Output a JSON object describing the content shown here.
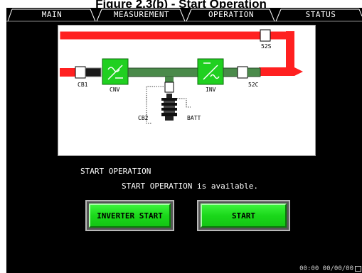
{
  "caption": "Figure 2.3(b) - Start Operation",
  "tabs": [
    {
      "label": "MAIN"
    },
    {
      "label": "MEASUREMENT"
    },
    {
      "label": "OPERATION"
    },
    {
      "label": "STATUS"
    }
  ],
  "diagram": {
    "labels": {
      "s52": "52S",
      "cb1": "CB1",
      "cnv": "CNV",
      "inv": "INV",
      "c52": "52C",
      "cb2": "CB2",
      "batt": "BATT"
    }
  },
  "message": {
    "title": "START OPERATION",
    "detail": "START OPERATION is available."
  },
  "buttons": {
    "inverter_start": "INVERTER START",
    "start": "START"
  },
  "status_bar": {
    "datetime": "00:00  00/00/00"
  }
}
